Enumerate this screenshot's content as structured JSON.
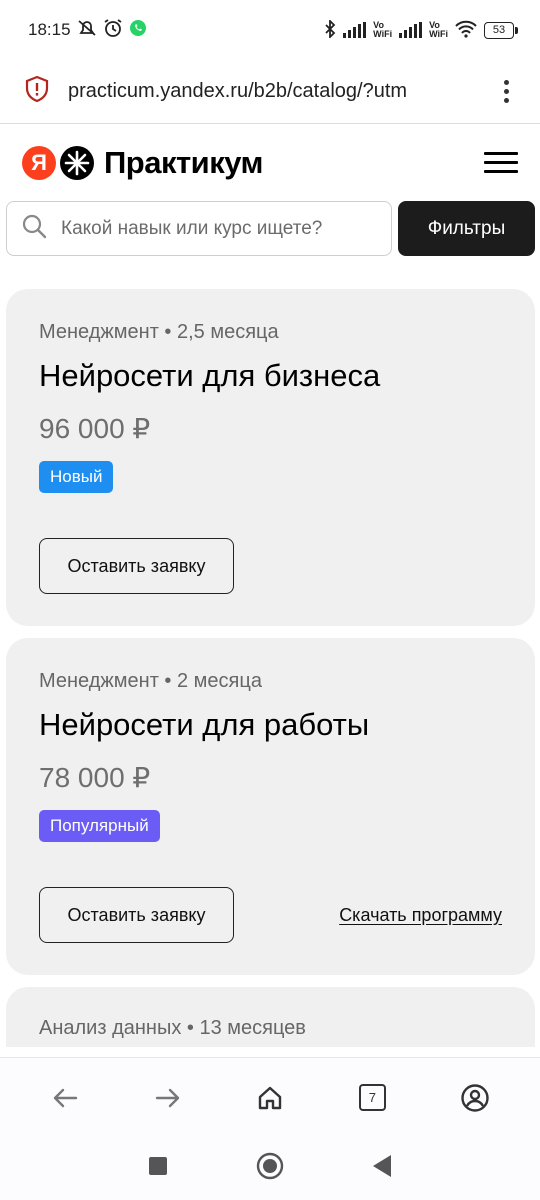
{
  "status_bar": {
    "time": "18:15",
    "battery": "53",
    "vowifi_1": [
      "Vo",
      "WiFi"
    ],
    "vowifi_2": [
      "Vo",
      "WiFi"
    ]
  },
  "browser": {
    "url": "practicum.yandex.ru/b2b/catalog/?utm",
    "tab_count": "7"
  },
  "site": {
    "logo_letter": "Я",
    "logo_text": "Практикум"
  },
  "search": {
    "placeholder": "Какой навык или курс ищете?",
    "filter_label": "Фильтры"
  },
  "courses": [
    {
      "meta": "Менеджмент • 2,5 месяца",
      "title": "Нейросети для бизнеса",
      "price": "96 000 ₽",
      "badge": "Новый",
      "badge_color": "#1f8ef1",
      "apply_label": "Оставить заявку"
    },
    {
      "meta": "Менеджмент • 2 месяца",
      "title": "Нейросети для работы",
      "price": "78 000 ₽",
      "badge": "Популярный",
      "badge_color": "#6b5cf6",
      "apply_label": "Оставить заявку",
      "download_label": "Скачать программу"
    },
    {
      "meta": "Анализ данных • 13 месяцев"
    }
  ],
  "colors": {
    "yandex_red": "#fc3f1d",
    "card_bg": "#f0f0f0",
    "filter_btn_bg": "#1c1c1c"
  }
}
